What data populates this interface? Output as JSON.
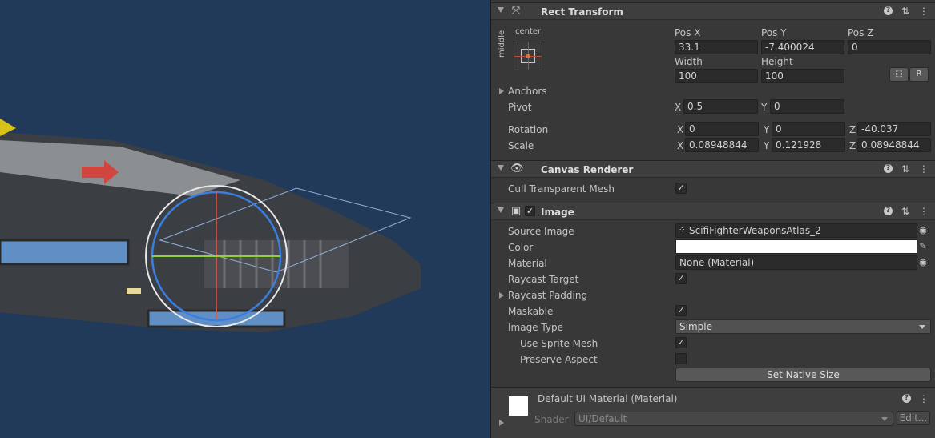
{
  "colors": {
    "scene_bg": "#223a5a",
    "inspector_bg": "#383838",
    "field_bg": "#2a2a2a",
    "color_swatch": "#ffffff"
  },
  "rect_transform": {
    "title": "Rect Transform",
    "anchor_preset": {
      "horizontal": "center",
      "vertical": "middle"
    },
    "headers": {
      "pos_x": "Pos X",
      "pos_y": "Pos Y",
      "pos_z": "Pos Z",
      "width": "Width",
      "height": "Height"
    },
    "values": {
      "pos_x": "33.1",
      "pos_y": "-7.400024",
      "pos_z": "0",
      "width": "100",
      "height": "100"
    },
    "blueprint_btn": "⬚",
    "raw_btn": "R",
    "anchors_label": "Anchors",
    "pivot": {
      "label": "Pivot",
      "x_axis": "X",
      "x": "0.5",
      "y_axis": "Y",
      "y": "0"
    },
    "rotation": {
      "label": "Rotation",
      "x_axis": "X",
      "x": "0",
      "y_axis": "Y",
      "y": "0",
      "z_axis": "Z",
      "z": "-40.037"
    },
    "scale": {
      "label": "Scale",
      "x_axis": "X",
      "x": "0.08948844",
      "y_axis": "Y",
      "y": "0.121928",
      "z_axis": "Z",
      "z": "0.08948844"
    }
  },
  "canvas_renderer": {
    "title": "Canvas Renderer",
    "cull_label": "Cull Transparent Mesh",
    "cull_checked": true
  },
  "image": {
    "title": "Image",
    "enabled": true,
    "source_image_label": "Source Image",
    "source_image_value": "ScifiFighterWeaponsAtlas_2",
    "color_label": "Color",
    "material_label": "Material",
    "material_value": "None (Material)",
    "raycast_target_label": "Raycast Target",
    "raycast_target": true,
    "raycast_padding_label": "Raycast Padding",
    "maskable_label": "Maskable",
    "maskable": true,
    "image_type_label": "Image Type",
    "image_type_value": "Simple",
    "use_sprite_mesh_label": "Use Sprite Mesh",
    "use_sprite_mesh": true,
    "preserve_aspect_label": "Preserve Aspect",
    "preserve_aspect": false,
    "set_native_size": "Set Native Size"
  },
  "material": {
    "title": "Default UI Material (Material)",
    "shader_label": "Shader",
    "shader_value": "UI/Default",
    "edit_btn": "Edit..."
  },
  "icons": {
    "check": "✓",
    "help": "?",
    "presets": "⇅",
    "more": "⋮",
    "target": "◉",
    "eyedropper": "✎"
  }
}
